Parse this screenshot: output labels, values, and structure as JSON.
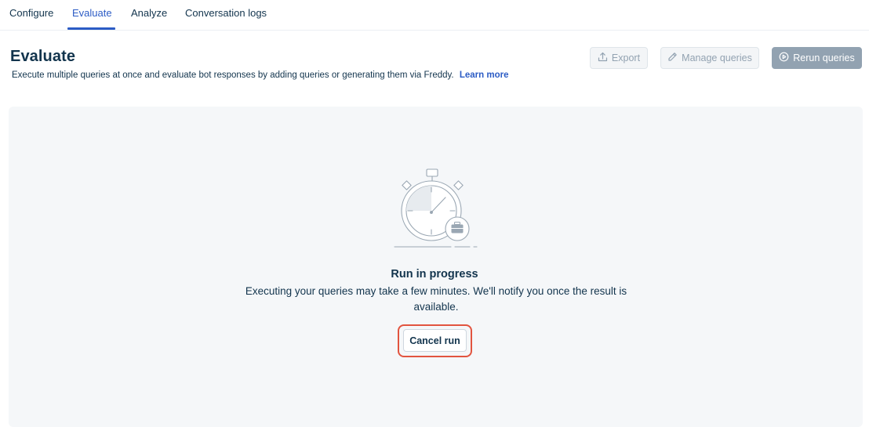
{
  "tabs": [
    {
      "label": "Configure",
      "active": false
    },
    {
      "label": "Evaluate",
      "active": true
    },
    {
      "label": "Analyze",
      "active": false
    },
    {
      "label": "Conversation logs",
      "active": false
    }
  ],
  "header": {
    "title": "Evaluate",
    "description": "Execute multiple queries at once and evaluate bot responses by adding queries or generating them via Freddy.",
    "learn_more": "Learn more"
  },
  "actions": {
    "export_label": "Export",
    "manage_label": "Manage queries",
    "rerun_label": "Rerun queries",
    "disabled": true
  },
  "status": {
    "title": "Run in progress",
    "description": "Executing your queries may take a few minutes. We'll notify you once the result is available.",
    "cancel_label": "Cancel run"
  },
  "colors": {
    "accent": "#2c5cc5",
    "text": "#12344d",
    "disabled": "#92a2b1",
    "panel": "#f5f7f9",
    "highlight": "#e2543f"
  },
  "icons": {
    "export": "upload-icon",
    "manage": "pencil-icon",
    "rerun": "play-circle-icon",
    "illustration": "stopwatch-briefcase-illustration"
  }
}
